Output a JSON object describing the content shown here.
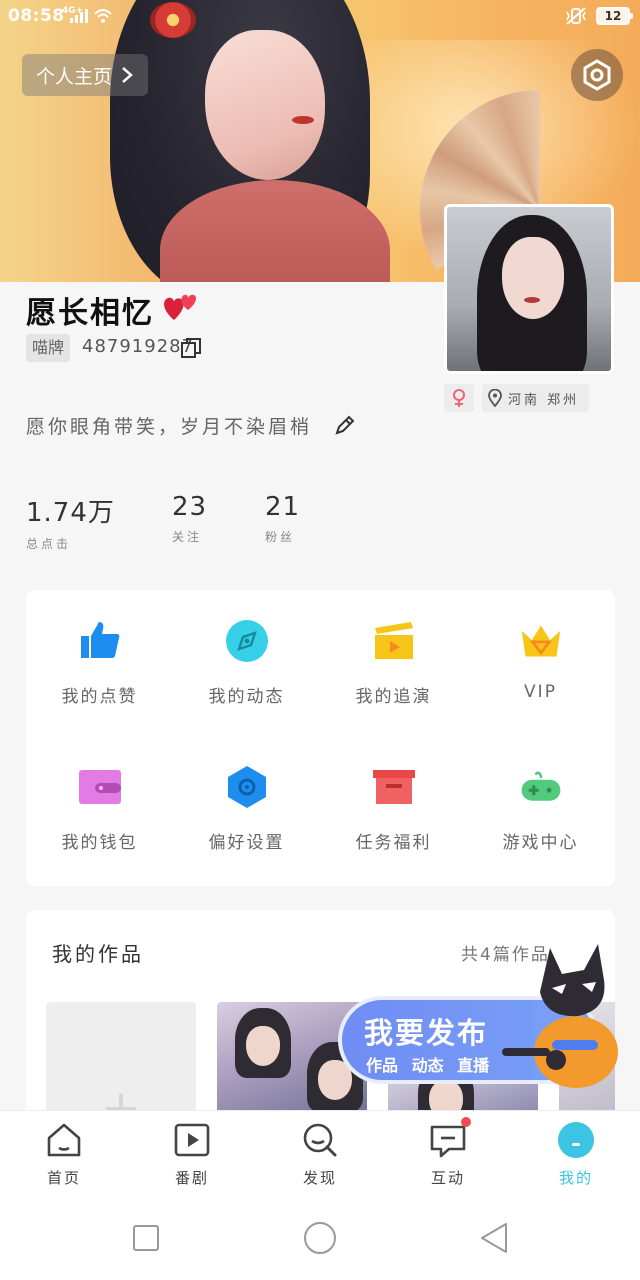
{
  "status_bar": {
    "time": "08:58",
    "network": "4G+",
    "battery": "12"
  },
  "header": {
    "homepage_label": "个人主页"
  },
  "profile": {
    "username": "愿长相忆",
    "id_badge": "喵牌",
    "id_value": "487919287",
    "location": "河南 郑州",
    "signature": "愿你眼角带笑，岁月不染眉梢"
  },
  "stats": [
    {
      "value": "1.74万",
      "label": "总点击"
    },
    {
      "value": "23",
      "label": "关注"
    },
    {
      "value": "21",
      "label": "粉丝"
    }
  ],
  "grid": [
    {
      "label": "我的点赞",
      "icon": "thumbs-up-icon",
      "color": "#1e8df0"
    },
    {
      "label": "我的动态",
      "icon": "compass-icon",
      "color": "#36d1e8"
    },
    {
      "label": "我的追演",
      "icon": "clapperboard-icon",
      "color": "#f7c517"
    },
    {
      "label": "VIP",
      "icon": "crown-icon",
      "color": "#f7c517"
    },
    {
      "label": "我的钱包",
      "icon": "wallet-icon",
      "color": "#e37be4"
    },
    {
      "label": "偏好设置",
      "icon": "hexagon-settings-icon",
      "color": "#1e8df0"
    },
    {
      "label": "任务福利",
      "icon": "gift-box-icon",
      "color": "#f06262"
    },
    {
      "label": "游戏中心",
      "icon": "gamepad-icon",
      "color": "#52c97d"
    }
  ],
  "works": {
    "title": "我的作品",
    "count": "共4篇作品"
  },
  "publish": {
    "title": "我要发布",
    "subtitle": "作品 动态 直播"
  },
  "bottom_nav": [
    {
      "label": "首页",
      "icon": "home-icon"
    },
    {
      "label": "番剧",
      "icon": "play-icon"
    },
    {
      "label": "发现",
      "icon": "discover-icon"
    },
    {
      "label": "互动",
      "icon": "message-icon"
    },
    {
      "label": "我的",
      "icon": "profile-icon"
    }
  ],
  "colors": {
    "accent": "#3cc4e4",
    "publish": "#7499f5",
    "notification": "#f04a55"
  }
}
